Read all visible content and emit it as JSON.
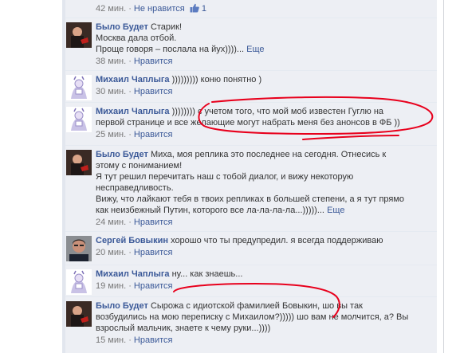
{
  "top_meta": {
    "time": "42 мин.",
    "sep": " · ",
    "dislike": "Не нравится",
    "count": "1"
  },
  "comments": [
    {
      "author": "Было Будет",
      "text_first": "Старик!",
      "lines": [
        "Москва дала отбой.",
        "Проще говоря – послала на йух))))..."
      ],
      "more": "Еще",
      "time": "38 мин.",
      "like": "Нравится"
    },
    {
      "author": "Михаил Чаплыга",
      "text_first": "))))))))) коню понятно )",
      "lines": [],
      "time": "30 мин.",
      "like": "Нравится"
    },
    {
      "author": "Михаил Чаплыга",
      "text_first": ")))))))) с учетом того, что мой моб известен Гуглю на",
      "lines": [
        "первой странице и все желающие могут набрать меня без анонсов в ФБ ))"
      ],
      "time": "25 мин.",
      "like": "Нравится"
    },
    {
      "author": "Было Будет",
      "text_first": "Миха, моя реплика это последнее на сегодня. Отнесись к",
      "lines": [
        "этому с пониманием!",
        "Я тут решил перечитать наш с тобой диалог, и вижу некоторую",
        "несправедливость.",
        "Вижу, что лайкают тебя в твоих репликах в большей степени, а я тут прямо",
        "как неизбежный Путин, которого все ла-ла-ла-ла...)))))..."
      ],
      "more": "Еще",
      "time": "24 мин.",
      "like": "Нравится"
    },
    {
      "author": "Сергей Бовыкин",
      "text_first": "хорошо что ты предупредил. я всегда поддерживаю",
      "lines": [],
      "time": "20 мин.",
      "like": "Нравится"
    },
    {
      "author": "Михаил Чаплыга",
      "text_first": "ну... как знаешь...",
      "lines": [],
      "time": "19 мин.",
      "like": "Нравится"
    },
    {
      "author": "Было Будет",
      "text_first": "Сырожа с идиотской фамилией Бовыкин, шо вы так",
      "lines": [
        "возбудились на мою переписку с Михаилом?))))) шо вам не молчится, а? Вы",
        "взрослый мальчик, знаете к чему руки...))))"
      ],
      "time": "15 мин.",
      "like": "Нравится"
    }
  ],
  "colors": {
    "link": "#3b5998",
    "meta": "#777777",
    "thread_bg": "#edeff4",
    "annotation": "#e8001c"
  }
}
